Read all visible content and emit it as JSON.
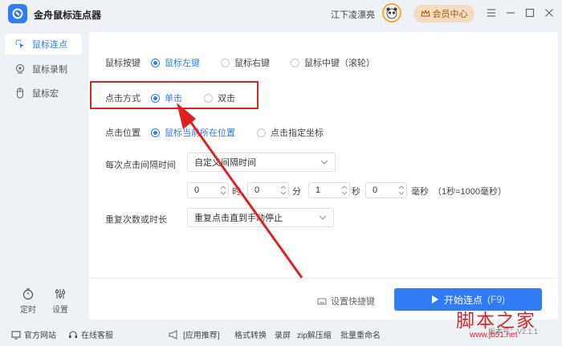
{
  "app": {
    "title": "金舟鼠标连点器",
    "username": "江下凌漂亮",
    "member_label": "会员中心"
  },
  "sidebar": {
    "items": [
      {
        "label": "鼠标连点",
        "icon": "cursor-click-icon",
        "active": true
      },
      {
        "label": "鼠标录制",
        "icon": "record-pin-icon",
        "active": false
      },
      {
        "label": "鼠标宏",
        "icon": "mouse-icon",
        "active": false
      }
    ],
    "tools": [
      {
        "label": "定时",
        "icon": "timer-icon"
      },
      {
        "label": "设置",
        "icon": "sliders-icon"
      }
    ]
  },
  "settings": {
    "button": {
      "label": "鼠标按键",
      "options": [
        "鼠标左键",
        "鼠标右键",
        "鼠标中键（滚轮）"
      ],
      "selected": 0
    },
    "mode": {
      "label": "点击方式",
      "options": [
        "单击",
        "双击"
      ],
      "selected": 0
    },
    "position": {
      "label": "点击位置",
      "options": [
        "鼠标当前所在位置",
        "点击指定坐标"
      ],
      "selected": 0
    },
    "interval": {
      "label": "每次点击间隔时间",
      "select_value": "自定义间隔时间",
      "fields": [
        {
          "value": "0",
          "unit": "时"
        },
        {
          "value": "0",
          "unit": "分"
        },
        {
          "value": "1",
          "unit": "秒"
        },
        {
          "value": "0",
          "unit": "毫秒"
        }
      ],
      "note": "（1秒=1000毫秒）"
    },
    "repeat": {
      "label": "重复次数或时长",
      "select_value": "重复点击直到手动停止"
    }
  },
  "actions": {
    "shortcut_label": "设置快捷键",
    "start_label": "开始连点",
    "start_hotkey": "(F9)"
  },
  "footer": {
    "website": "官方网站",
    "service": "在线客服",
    "recommend": "[应用推荐]",
    "links": [
      "格式转换",
      "录屏",
      "zip解压缩",
      "批量重命名"
    ],
    "version": "版本号：V2.1.1"
  },
  "watermark": {
    "text": "脚本之家",
    "url": "www.jb51.net"
  },
  "colors": {
    "accent": "#2f7cf6",
    "annotation": "#e02020",
    "member_bg": "#f3dcc0"
  }
}
